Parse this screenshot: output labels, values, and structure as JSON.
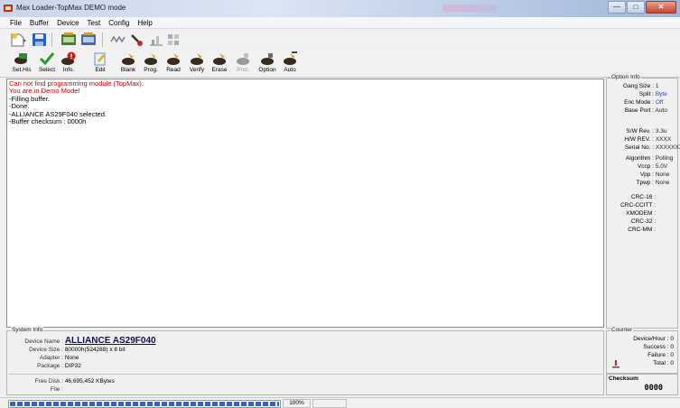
{
  "window": {
    "title": "Max Loader-TopMax DEMO mode",
    "controls": [
      "minimize",
      "maximize",
      "close"
    ]
  },
  "menu": [
    "File",
    "Buffer",
    "Device",
    "Test",
    "Config",
    "Help"
  ],
  "toolbar_top": [
    "new-file-icon",
    "save-icon",
    "chip-read-icon",
    "chip-write-icon",
    "waveform-icon",
    "probe-icon",
    "chart-icon",
    "grid-icon"
  ],
  "toolbar_main": [
    {
      "label": "Set.His",
      "icon": "chip-icon",
      "enabled": true
    },
    {
      "label": "Select",
      "icon": "check-icon",
      "enabled": true
    },
    {
      "label": "Info.",
      "icon": "info-icon",
      "enabled": true
    },
    {
      "label": "Edit",
      "icon": "edit-icon",
      "enabled": true
    },
    {
      "label": "Blank",
      "icon": "blank-icon",
      "enabled": true
    },
    {
      "label": "Prog.",
      "icon": "program-icon",
      "enabled": true
    },
    {
      "label": "Read",
      "icon": "read-icon",
      "enabled": true
    },
    {
      "label": "Verify",
      "icon": "verify-icon",
      "enabled": true
    },
    {
      "label": "Erase",
      "icon": "erase-icon",
      "enabled": true
    },
    {
      "label": "Prot.",
      "icon": "protect-icon",
      "enabled": false
    },
    {
      "label": "Option",
      "icon": "option-icon",
      "enabled": true
    },
    {
      "label": "Auto",
      "icon": "auto-icon",
      "enabled": true
    }
  ],
  "log": [
    {
      "text": "Can not find programming module (TopMax).",
      "color": "#d00000"
    },
    {
      "text": "You are in Demo Mode!",
      "color": "#d00000"
    },
    {
      "text": "-Filling buffer.",
      "color": "#000000"
    },
    {
      "text": "-Done.",
      "color": "#000000"
    },
    {
      "text": "-ALLIANCE AS29F040 selected.",
      "color": "#000000"
    },
    {
      "text": "-Buffer checksum : 0000h",
      "color": "#000000"
    }
  ],
  "option_info": {
    "title": "Option Info",
    "rows_a": [
      {
        "key": "Gang Size :",
        "value": "1"
      },
      {
        "key": "Split :",
        "value": "Byte"
      },
      {
        "key": "Enc Mode :",
        "value": "Off"
      },
      {
        "key": "Base Port :",
        "value": "Auto"
      }
    ],
    "rows_b": [
      {
        "key": "S/W Rev. :",
        "value": "3.3u"
      },
      {
        "key": "H/W REV. :",
        "value": "XXXX"
      },
      {
        "key": "Serial No. :",
        "value": "XXXXXXX"
      }
    ],
    "rows_c": [
      {
        "key": "Algorithm :",
        "value": "Polling"
      },
      {
        "key": "Vccp :",
        "value": "5.0V"
      },
      {
        "key": "Vpp :",
        "value": "None"
      },
      {
        "key": "Tpwp :",
        "value": "None"
      }
    ],
    "crc": [
      "CRC-16 :",
      "CRC-CCITT :",
      "XMODEM :",
      "CRC-32 :",
      "CRC-MM :"
    ]
  },
  "system_info": {
    "title": "System Info",
    "device_name_key": "Device Name :",
    "device_name": "ALLIANCE AS29F040",
    "device_size_key": "Device Size :",
    "device_size": "80000h(524288) x 8 bit",
    "adapter_key": "Adapter :",
    "adapter": "None",
    "package_key": "Package :",
    "package": "DIP32",
    "free_disk_key": "Free Disk :",
    "free_disk": "46,695,452 KBytes",
    "file_key": "File :",
    "file": ""
  },
  "counter": {
    "title": "Counter",
    "rows": [
      {
        "key": "Device/Hour :",
        "value": "0"
      },
      {
        "key": "Success :",
        "value": "0"
      },
      {
        "key": "Failure :",
        "value": "0"
      },
      {
        "key": "Total :",
        "value": "0"
      }
    ]
  },
  "checksum": {
    "title": "Checksum",
    "value": "0000"
  },
  "status": {
    "progress_percent": 100,
    "progress_label": "100%"
  }
}
